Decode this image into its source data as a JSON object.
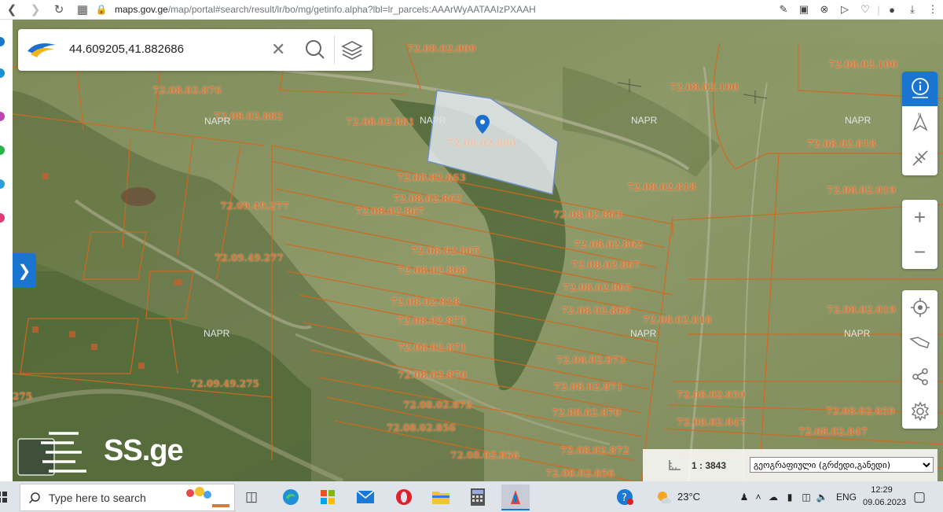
{
  "browser": {
    "url_host": "maps.gov.ge",
    "url_path": "/map/portal#search/result/lr/bo/mg/getinfo.alpha?lbl=lr_parcels:AAArWyAATAAIzPXAAH"
  },
  "search": {
    "value": "44.609205,41.882686"
  },
  "map": {
    "parcel_labels": [
      "72.08.02.009",
      "72.08.02.100",
      "72.08.02.100",
      "72.08.02.876",
      "72.08.02.882",
      "72.08.02.881",
      "72.08.02.880",
      "72.08.02.818",
      "72.08.02.863",
      "72.08.02.818",
      "72.08.02.019",
      "72.08.02.862",
      "72.09.49.277",
      "72.08.02.867",
      "72.08.02.863",
      "72.08.02.862",
      "72.08.02.865",
      "72.09.49.277",
      "72.08.02.867",
      "72.08.02.868",
      "72.08.02.865",
      "72.08.02.818",
      "72.08.02.868",
      "72.08.02.818",
      "72.08.02.019",
      "72.08.02.873",
      "72.08.02.871",
      "72.08.02.873",
      "72.08.02.870",
      "72.09.49.275",
      "72.08.02.871",
      "72.08.02.859",
      "275",
      "72.08.02.872",
      "72.08.02.870",
      "72.08.02.859",
      "72.08.02.856",
      "72.08.02.847",
      "72.08.02.847",
      "72.08.02.872",
      "72.08.02.856",
      "72.08.02.856",
      "72.08.02.84",
      "72.08.02.845",
      "72.08.02.882"
    ],
    "napr_labels": [
      "NAPR",
      "NAPR",
      "NAPR",
      "NAPR",
      "NAPR",
      "NAPR",
      "NAPR"
    ]
  },
  "scale": {
    "value": "1 : 3843",
    "basemap_selected": "გეოგრაფიული (გრძედი,განედი)"
  },
  "watermark": {
    "text": "SS.ge"
  },
  "taskbar": {
    "search_placeholder": "Type here to search",
    "weather": "23°C",
    "language": "ENG",
    "time": "12:29",
    "date": "09.06.2023"
  },
  "colors": {
    "accent": "#1a75d1",
    "parcel_line": "#d2691e",
    "label": "#d9773a",
    "selected_parcel": "#e8edf4"
  }
}
